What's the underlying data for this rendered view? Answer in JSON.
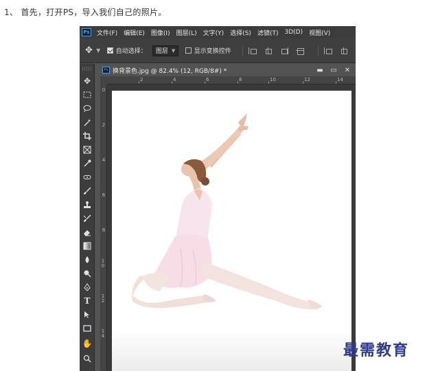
{
  "caption": "1、 首先，打开PS，导入我们自己的照片。",
  "menubar": {
    "logo": "Ps",
    "items": [
      "文件(F)",
      "编辑(E)",
      "图像(I)",
      "图层(L)",
      "文字(Y)",
      "选择(S)",
      "滤镜(T)",
      "3D(D)",
      "视图(V)"
    ]
  },
  "options": {
    "auto_select_label": "自动选择：",
    "auto_select_checked": true,
    "target_value": "图层",
    "show_transform_label": "显示变换控件",
    "show_transform_checked": false
  },
  "document": {
    "title": "换背景色.jpg @ 82.4% (12, RGB/8#) *",
    "ps_icon": "Ps",
    "minimize": "▬",
    "maximize": "▭",
    "close": "✕",
    "ruler_top": [
      "2",
      "4",
      "6",
      "8",
      "10",
      "12",
      "14"
    ],
    "ruler_left": [
      "0",
      "2",
      "4",
      "6",
      "8",
      "1 0",
      "1 2",
      "1 4"
    ]
  },
  "tools": [
    "move-icon",
    "marquee-icon",
    "lasso-icon",
    "magic-wand-icon",
    "crop-icon",
    "frame-icon",
    "eyedropper-icon",
    "healing-icon",
    "brush-icon",
    "stamp-icon",
    "history-brush-icon",
    "eraser-icon",
    "gradient-icon",
    "blur-icon",
    "dodge-icon",
    "pen-icon",
    "type-icon",
    "path-select-icon",
    "rectangle-icon",
    "hand-icon",
    "zoom-icon"
  ],
  "watermark": "最需教育",
  "colors": {
    "ps_blue": "#31a8ff",
    "watermark": "#2b3b8f",
    "chrome_dark": "#3c3c3c",
    "chrome_mid": "#535353"
  }
}
